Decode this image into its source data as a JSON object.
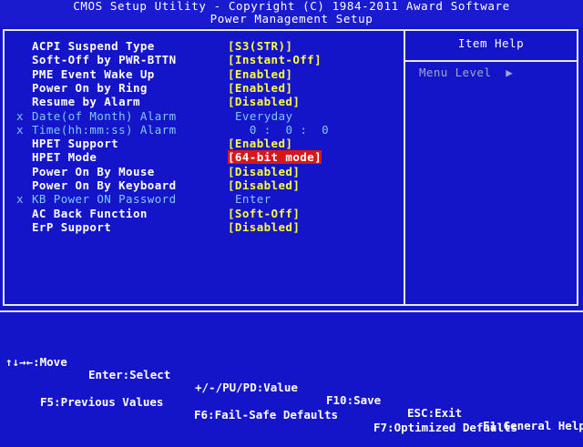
{
  "header": {
    "title": "CMOS Setup Utility - Copyright (C) 1984-2011 Award Software",
    "subtitle": "Power Management Setup"
  },
  "settings": [
    {
      "label": "ACPI Suspend Type",
      "value": "[S3(STR)]",
      "marker": "",
      "disabled": false,
      "selected": false
    },
    {
      "label": "Soft-Off by PWR-BTTN",
      "value": "[Instant-Off]",
      "marker": "",
      "disabled": false,
      "selected": false
    },
    {
      "label": "PME Event Wake Up",
      "value": "[Enabled]",
      "marker": "",
      "disabled": false,
      "selected": false
    },
    {
      "label": "Power On by Ring",
      "value": "[Enabled]",
      "marker": "",
      "disabled": false,
      "selected": false
    },
    {
      "label": "Resume by Alarm",
      "value": "[Disabled]",
      "marker": "",
      "disabled": false,
      "selected": false
    },
    {
      "label": "Date(of Month) Alarm",
      "value": "Everyday",
      "marker": "x",
      "disabled": true,
      "selected": false
    },
    {
      "label": "Time(hh:mm:ss) Alarm",
      "value": "  0 :  0 :  0",
      "marker": "x",
      "disabled": true,
      "selected": false
    },
    {
      "label": "HPET Support",
      "value": "[Enabled]",
      "marker": "",
      "disabled": false,
      "selected": false
    },
    {
      "label": "HPET Mode",
      "value": "[64-bit mode]",
      "marker": "",
      "disabled": false,
      "selected": true
    },
    {
      "label": "Power On By Mouse",
      "value": "[Disabled]",
      "marker": "",
      "disabled": false,
      "selected": false
    },
    {
      "label": "Power On By Keyboard",
      "value": "[Disabled]",
      "marker": "",
      "disabled": false,
      "selected": false
    },
    {
      "label": "KB Power ON Password",
      "value": "Enter",
      "marker": "x",
      "disabled": true,
      "selected": false
    },
    {
      "label": "AC Back Function",
      "value": "[Soft-Off]",
      "marker": "",
      "disabled": false,
      "selected": false
    },
    {
      "label": "ErP Support",
      "value": "[Disabled]",
      "marker": "",
      "disabled": false,
      "selected": false
    }
  ],
  "help_panel": {
    "title": "Item Help",
    "menu_level": "Menu Level",
    "arrow": "▶"
  },
  "footer": {
    "line1": [
      {
        "text": "↑↓→←:Move"
      },
      {
        "text": "Enter:Select"
      },
      {
        "text": "+/-/PU/PD:Value"
      },
      {
        "text": "F10:Save"
      },
      {
        "text": "ESC:Exit"
      },
      {
        "text": "F1:General Help"
      }
    ],
    "line2": [
      {
        "text": "F5:Previous Values"
      },
      {
        "text": "F6:Fail-Safe Defaults"
      },
      {
        "text": "F7:Optimized Defaults"
      }
    ]
  },
  "colors": {
    "background": "#1414c8",
    "label": "#ffffff",
    "value": "#ffff40",
    "disabled": "#7fc8ff",
    "selected_bg": "#d81818"
  }
}
